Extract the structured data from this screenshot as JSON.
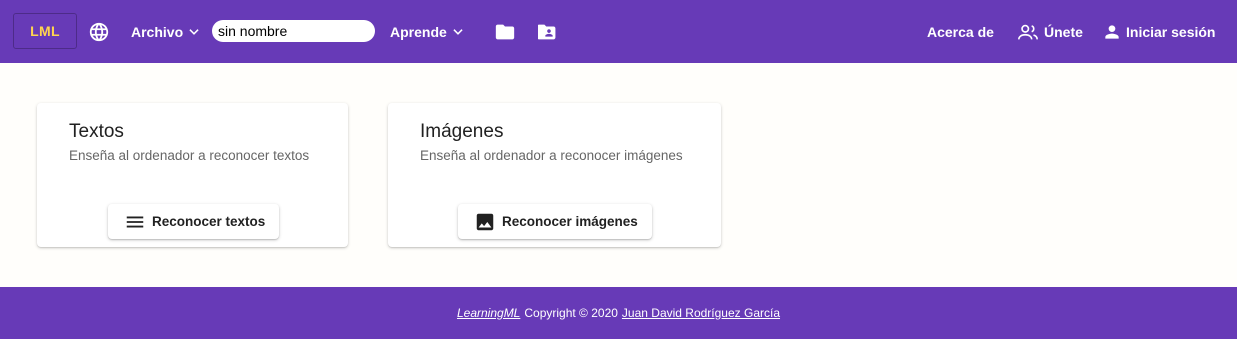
{
  "header": {
    "logo": "LML",
    "language_icon": "globe-icon",
    "file_menu": "Archivo",
    "project_name": "sin nombre",
    "learn_menu": "Aprende",
    "open_icon": "folder-icon",
    "shared_icon": "folder-account-icon",
    "about": "Acerca de",
    "join": "Únete",
    "login": "Iniciar sesión"
  },
  "cards": [
    {
      "title": "Textos",
      "subtitle": "Enseña al ordenador a reconocer textos",
      "button": "Reconocer textos",
      "icon": "lines-icon"
    },
    {
      "title": "Imágenes",
      "subtitle": "Enseña al ordenador a reconocer imágenes",
      "button": "Reconocer imágenes",
      "icon": "image-icon"
    }
  ],
  "footer": {
    "app_name": "LearningML",
    "copyright": "Copyright © 2020",
    "author": "Juan David Rodríguez García"
  },
  "colors": {
    "primary": "#673ab7",
    "logo_text": "#ffd54f"
  }
}
